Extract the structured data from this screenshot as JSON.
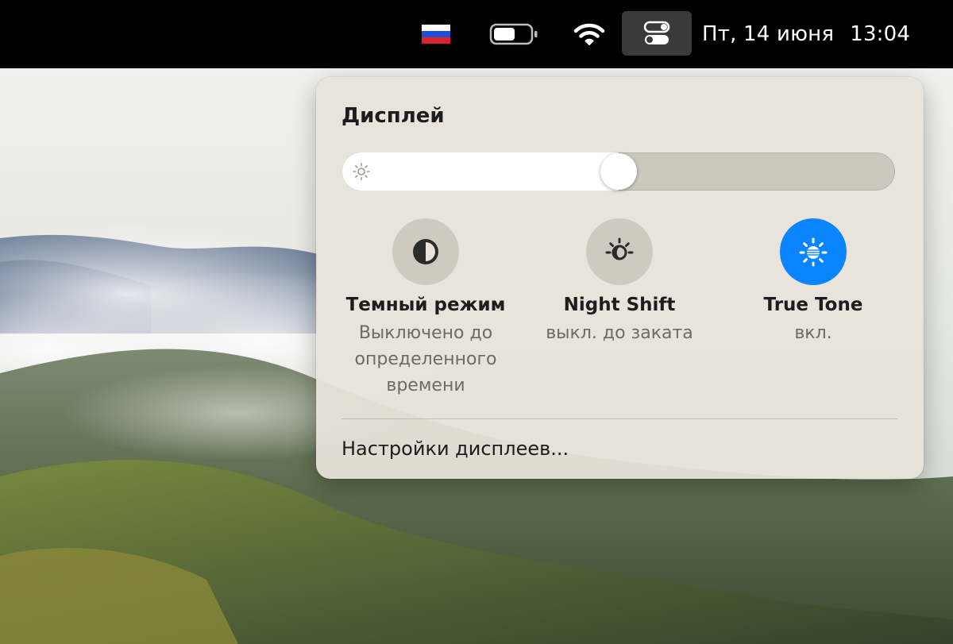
{
  "menubar": {
    "input_source_icon": "russian-flag-icon",
    "battery_icon": "battery-icon",
    "wifi_icon": "wifi-icon",
    "control_center_icon": "control-center-toggles-icon",
    "date": "Пт, 14 июня",
    "time": "13:04"
  },
  "panel": {
    "title": "Дисплей",
    "brightness": {
      "icon": "sun-small-icon",
      "level": 0.5
    },
    "toggles": [
      {
        "title": "Темный режим",
        "status": "Выключено до определенного времени",
        "icon": "dark-mode-icon",
        "active": false
      },
      {
        "title": "Night Shift",
        "status": "выкл. до заката",
        "icon": "night-shift-icon",
        "active": false
      },
      {
        "title": "True Tone",
        "status": "вкл.",
        "icon": "true-tone-icon",
        "active": true
      }
    ],
    "settings_link": "Настройки дисплеев..."
  },
  "colors": {
    "accent": "#0a84ff",
    "panel_bg": "#e8e2da",
    "inactive_circle": "#cfc9c0",
    "menubar_bg": "#000000"
  }
}
